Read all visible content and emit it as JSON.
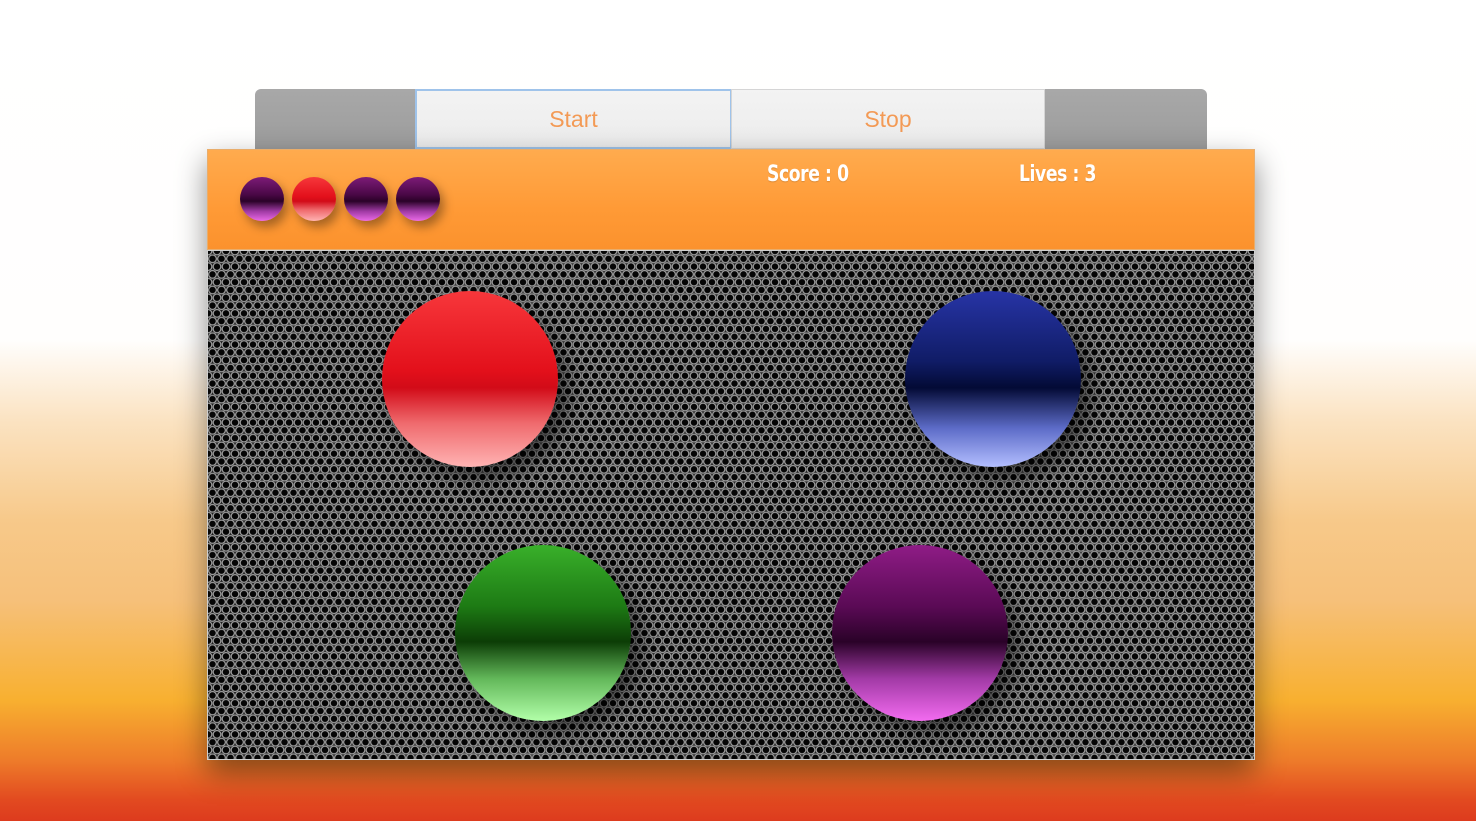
{
  "controls": {
    "start_label": "Start",
    "stop_label": "Stop"
  },
  "hud": {
    "score_text": "Score : 0",
    "lives_text": "Lives : 3"
  },
  "sequence": [
    "purple",
    "red",
    "purple",
    "purple"
  ],
  "orbs": [
    "red",
    "blue",
    "green",
    "purple"
  ],
  "colors": {
    "accent": "#ff9a36",
    "button_text": "#f39a55",
    "red": "#e3101b",
    "blue": "#101c66",
    "green": "#1d7a14",
    "purple": "#5a0a55"
  }
}
